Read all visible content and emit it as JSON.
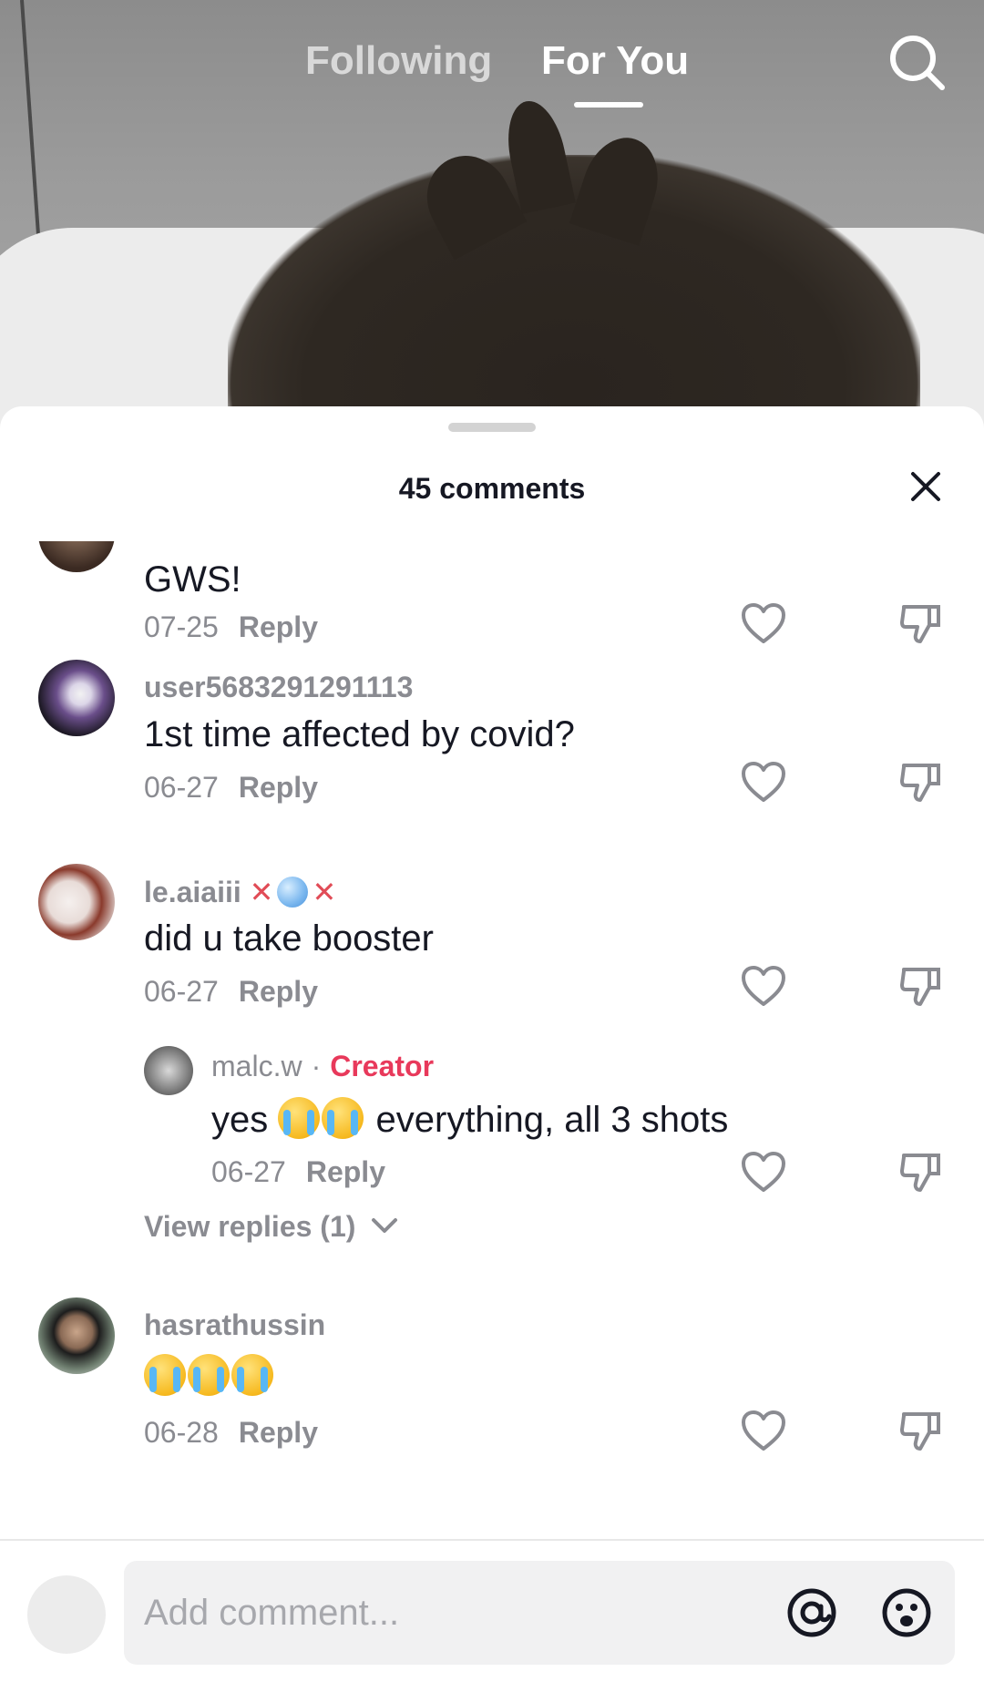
{
  "nav": {
    "tabs": [
      {
        "label": "Following"
      },
      {
        "label": "For You"
      }
    ],
    "active_tab": "For You",
    "search_icon": "search-icon"
  },
  "sheet": {
    "title": "45 comments",
    "close_icon": "close-icon"
  },
  "comments": [
    {
      "username": "",
      "text": "GWS!",
      "date": "07-25",
      "reply": "Reply"
    },
    {
      "username": "user5683291291113",
      "text": "1st time affected by covid?",
      "date": "06-27",
      "reply": "Reply"
    },
    {
      "username": "le.aiaiii",
      "username_prefix": "",
      "text": "did u take booster",
      "date": "06-27",
      "reply": "Reply",
      "replies": [
        {
          "username": "malc.w",
          "separator": "·",
          "badge": "Creator",
          "text_before": "yes",
          "text_after": "everything, all 3 shots",
          "date": "06-27",
          "reply": "Reply"
        }
      ],
      "view_replies": "View replies (1)"
    },
    {
      "username": "hasrathussin",
      "text": "",
      "date": "06-28",
      "reply": "Reply"
    }
  ],
  "composer": {
    "placeholder": "Add comment...",
    "at_icon": "at-icon",
    "emoji_icon": "emoji-icon"
  },
  "colors": {
    "creator_badge": "#e8395b",
    "muted_text": "#8a8b91",
    "primary_text": "#161823"
  }
}
